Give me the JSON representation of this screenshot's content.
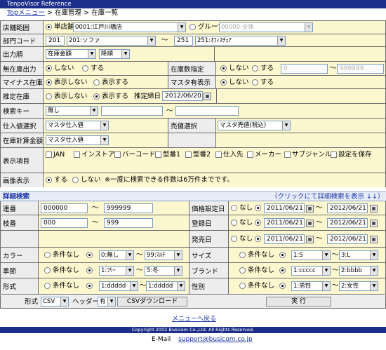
{
  "app_title": "TenpoVisor Reference",
  "breadcrumb": {
    "top": "Topメニュー",
    "sep1": " > ",
    "mid": "在庫管理",
    "sep2": " > ",
    "cur": "在庫一覧"
  },
  "store": {
    "label": "店舗範囲",
    "single_label": "単店舗",
    "store_value": "0001:江戸川橋店",
    "group_label": "グループ",
    "group_value": "00000:全体"
  },
  "dept": {
    "label": "部門コード",
    "from_code": "201",
    "from_value": "201:ソファ",
    "tilde": "〜",
    "to_code": "251",
    "to_value": "251:ｵﾌｨｽﾁｪｱ"
  },
  "order": {
    "label": "出力順",
    "value": "在庫金額",
    "dir": "降順"
  },
  "zero_stock": {
    "label": "無在庫出力",
    "opt_no": "しない",
    "opt_yes": "する"
  },
  "qty_spec": {
    "label": "在庫数指定",
    "opt_no": "しない",
    "opt_yes": "する",
    "from": "0",
    "tilde": "〜",
    "to": "999999"
  },
  "minus": {
    "label": "マイナス在庫",
    "opt_hide": "表示しない",
    "opt_show": "表示する"
  },
  "master": {
    "label": "マスタ有表示",
    "opt_no": "しない",
    "opt_yes": "する"
  },
  "estimate": {
    "label": "推定在庫",
    "opt_hide": "表示しない",
    "opt_show": "表示する",
    "date_label": "推定締日",
    "date": "2012/06/20"
  },
  "search_key": {
    "label": "検索キー",
    "value": "無し",
    "tilde": "〜"
  },
  "purchase_price": {
    "label": "仕入値選択",
    "value": "マスタ仕入値"
  },
  "sales_price": {
    "label": "売値選択",
    "value": "マスタ売値(税込)"
  },
  "calc_price": {
    "label": "在庫計算金額",
    "value": "マスタ仕入値"
  },
  "display_items": {
    "label": "表示項目",
    "items": [
      "JAN",
      "インストア",
      "バーコード",
      "型番1",
      "型番2",
      "仕入先",
      "メーカー",
      "サブジャンル",
      "設定を保存"
    ]
  },
  "image": {
    "label": "画像表示",
    "opt_yes": "する",
    "opt_no": "しない",
    "note": "※一度に検索できる件数は6万件までです。"
  },
  "detail": {
    "title": "詳細検索",
    "toggle": "（クリックにて詳細検索を表示 ↓↓）"
  },
  "serial": {
    "label": "連番",
    "from": "000000",
    "tilde": "〜",
    "to": "999999"
  },
  "branch": {
    "label": "枝番",
    "from": "000",
    "tilde": "〜",
    "to": "999"
  },
  "price_date": {
    "label": "価格設定日",
    "opt_none": "なし",
    "from": "2011/06/21",
    "tilde": "〜",
    "to": "2012/06/21"
  },
  "reg_date": {
    "label": "登録日",
    "opt_none": "なし",
    "from": "2011/06/21",
    "tilde": "〜",
    "to": "2012/06/21"
  },
  "sale_date": {
    "label": "発売日",
    "opt_none": "なし",
    "from": "2011/06/21",
    "tilde": "〜",
    "to": "2012/06/21"
  },
  "color": {
    "label": "カラー",
    "opt_none": "条件なし",
    "from": "0:無し",
    "tilde": "〜",
    "to": "99:ﾏﾙﾁ"
  },
  "size": {
    "label": "サイズ",
    "opt_none": "条件なし",
    "from": "1:S",
    "tilde": "〜",
    "to": "3:L"
  },
  "season": {
    "label": "季節",
    "opt_none": "条件なし",
    "from": "1:ﾌﾘｰ",
    "tilde": "〜",
    "to": "5:冬"
  },
  "brand": {
    "label": "ブランド",
    "opt_none": "条件なし",
    "from": "1:ccccc",
    "tilde": "〜",
    "to": "2:bbbb"
  },
  "shape": {
    "label": "形式",
    "opt_none": "条件なし",
    "from": "1:ddddd",
    "tilde": "〜",
    "to": "1:ddddd"
  },
  "gender": {
    "label": "性別",
    "opt_none": "条件なし",
    "from": "1:男性",
    "tilde": "〜",
    "to": "2:女性"
  },
  "bottom": {
    "format_label": "形式",
    "format": "CSV",
    "header_label": "ヘッダー",
    "header": "有",
    "csv_button": "CSVダウンロード",
    "run_button": "実 行"
  },
  "back_link": "メニューへ戻る",
  "copyright": "Copyright 2002 Busicom Co.,Ltd. All Rights Reserved.",
  "email_label": "E-Mail",
  "email": "support@busicom.co.jp"
}
